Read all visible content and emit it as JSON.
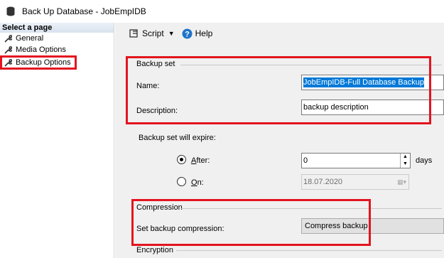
{
  "window": {
    "title": "Back Up Database - JobEmpIDB"
  },
  "sidebar": {
    "header": "Select a page",
    "items": [
      {
        "label": "General"
      },
      {
        "label": "Media Options"
      },
      {
        "label": "Backup Options"
      }
    ]
  },
  "toolbar": {
    "script_label": "Script",
    "help_label": "Help"
  },
  "backup_set": {
    "group_label": "Backup set",
    "name_label": "Name:",
    "name_value": "JobEmpIDB-Full Database Backup",
    "description_label": "Description:",
    "description_value": "backup description",
    "expire_label": "Backup set will expire:",
    "after_label": "After:",
    "after_value": "0",
    "after_unit": "days",
    "on_label": "On:",
    "on_value": "18.07.2020"
  },
  "compression": {
    "group_label": "Compression",
    "setting_label": "Set backup compression:",
    "setting_value": "Compress backup"
  },
  "encryption": {
    "group_label": "Encryption"
  },
  "colors": {
    "highlight": "#e3141f",
    "selection": "#0078d7"
  }
}
